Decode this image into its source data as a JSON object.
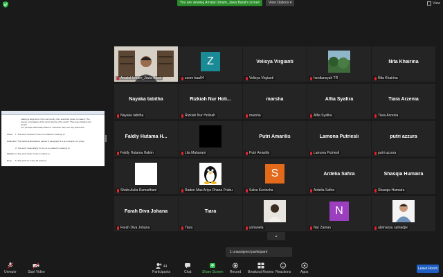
{
  "topbar": {
    "banner": "You are viewing Amalul Umam_Jawa Barat's screen",
    "view_options": "View Options ▾",
    "view": "View"
  },
  "shared_screen": {
    "top_text_1": "making a large dam in the community, they searched power to make it. The",
    "top_text_2": "money a Contagion of the local \"genius of the world\". They were helping and people",
    "top_text_3": "of a principle historically different. Therefore their own way acted with",
    "q1_label": "Wodin",
    "q1": "1. The word \"bucked\" in line 3 is related in meaning to:",
    "q2_label": "Datamilk",
    "q2": "2. The National Resiatance gained in paragraph 3 is an example of a group",
    "q3": "3. The word \"assembling\" in line 11 is related in meaning to:",
    "q4_label": "Matthew",
    "q4": "4. The word \"dusk\" in line 14 refers to:",
    "q5_label": "Rosy",
    "q5": "5. The word \"it\" in line 15 refers to:"
  },
  "tiles": [
    {
      "name": "",
      "label": "Amalul Umam_Jawa Barat",
      "type": "video"
    },
    {
      "name": "",
      "label": "zoom baa04",
      "type": "avatar",
      "initial": "Z",
      "color": "#1a8a96"
    },
    {
      "name": "Velisya Virgianti",
      "label": "Velisya Virgianti",
      "type": "name"
    },
    {
      "name": "",
      "label": "herdiansyah TR",
      "type": "photo"
    },
    {
      "name": "Nita Khairina",
      "label": "Nita Khairina",
      "type": "name"
    },
    {
      "name": "Nayaka tabitha",
      "label": "Nayaka tabitha",
      "type": "name"
    },
    {
      "name": "Rizkiah Nur Holi...",
      "label": "Rizkiah Nur Holizah",
      "type": "name"
    },
    {
      "name": "marsha",
      "label": "marsha",
      "type": "name"
    },
    {
      "name": "Alfia Syafira",
      "label": "Alfia Syafira",
      "type": "name"
    },
    {
      "name": "Tiara Arzenia",
      "label": "Tiara Arzenia",
      "type": "name"
    },
    {
      "name": "Faldly Hutama H...",
      "label": "Faldly Hutama Hakim",
      "type": "name"
    },
    {
      "name": "",
      "label": "Lila Maharani",
      "type": "black"
    },
    {
      "name": "Putri Amarilis",
      "label": "Putri Amarilis",
      "type": "name"
    },
    {
      "name": "Lamona Putriesli",
      "label": "Lamona Putriesli",
      "type": "name"
    },
    {
      "name": "putri azzura",
      "label": "putri azzura",
      "type": "name"
    },
    {
      "name": "",
      "label": "Shafa Aulia Ramadhani",
      "type": "white"
    },
    {
      "name": "",
      "label": "Raden Mas Ariya Dhana Prabu",
      "type": "penguin"
    },
    {
      "name": "",
      "label": "Salsa Kevincha",
      "type": "avatar",
      "initial": "S",
      "color": "#e36a1a"
    },
    {
      "name": "Ardelia Safira",
      "label": "Ardelia Safira",
      "type": "name"
    },
    {
      "name": "Shasqia Humaira",
      "label": "Shasqia Humaira",
      "type": "name"
    },
    {
      "name": "Farah Diva Johana",
      "label": "Farah Diva Johana",
      "type": "name"
    },
    {
      "name": "Tiara",
      "label": "Tiara",
      "type": "name"
    },
    {
      "name": "",
      "label": "yohaneta",
      "type": "portrait"
    },
    {
      "name": "",
      "label": "Nur Zaman",
      "type": "avatar",
      "initial": "N",
      "color": "#9b3fbf"
    },
    {
      "name": "",
      "label": "abimanyu satriadjie",
      "type": "portrait2"
    }
  ],
  "pager": {
    "label": "⌄"
  },
  "unassigned": "1 unassigned participant",
  "toolbar": {
    "unmute": "Unmute",
    "start_video": "Start Video",
    "participants": "Participants",
    "participants_count": "44",
    "chat": "Chat",
    "share_screen": "Share Screen",
    "record": "Record",
    "breakout": "Breakout Rooms",
    "reactions": "Reactions",
    "apps": "Apps",
    "leave": "Leave Room"
  }
}
